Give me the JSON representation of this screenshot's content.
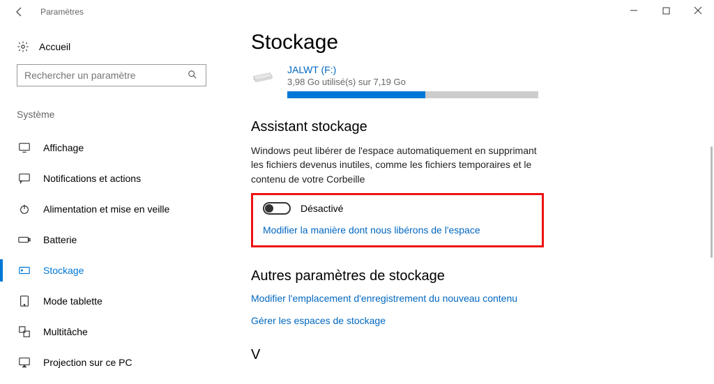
{
  "window": {
    "title": "Paramètres"
  },
  "sidebar": {
    "home": "Accueil",
    "search_placeholder": "Rechercher un paramètre",
    "category": "Système",
    "items": [
      {
        "icon": "display",
        "label": "Affichage"
      },
      {
        "icon": "chat",
        "label": "Notifications et actions"
      },
      {
        "icon": "power",
        "label": "Alimentation et mise en veille"
      },
      {
        "icon": "battery",
        "label": "Batterie"
      },
      {
        "icon": "storage",
        "label": "Stockage",
        "selected": true
      },
      {
        "icon": "tablet",
        "label": "Mode tablette"
      },
      {
        "icon": "multitask",
        "label": "Multitâche"
      },
      {
        "icon": "project",
        "label": "Projection sur ce PC"
      }
    ]
  },
  "page": {
    "title": "Stockage",
    "drive": {
      "name": "JALWT (F:)",
      "usage_text": "3,98 Go utilisé(s) sur 7,19 Go",
      "used_gb": 3.98,
      "total_gb": 7.19,
      "fill_percent": 55
    },
    "storage_sense": {
      "heading": "Assistant stockage",
      "description": "Windows peut libérer de l'espace automatiquement en supprimant les fichiers devenus inutiles, comme les fichiers temporaires et le contenu de votre Corbeille",
      "toggle_state": "off",
      "toggle_label": "Désactivé",
      "link": "Modifier la manière dont nous libérons de l'espace"
    },
    "other": {
      "heading": "Autres paramètres de stockage",
      "link1": "Modifier l'emplacement d'enregistrement du nouveau contenu",
      "link2": "Gérer les espaces de stockage"
    },
    "cutoff_text": "V"
  },
  "annotation": {
    "highlight": "storage_sense_controls"
  }
}
